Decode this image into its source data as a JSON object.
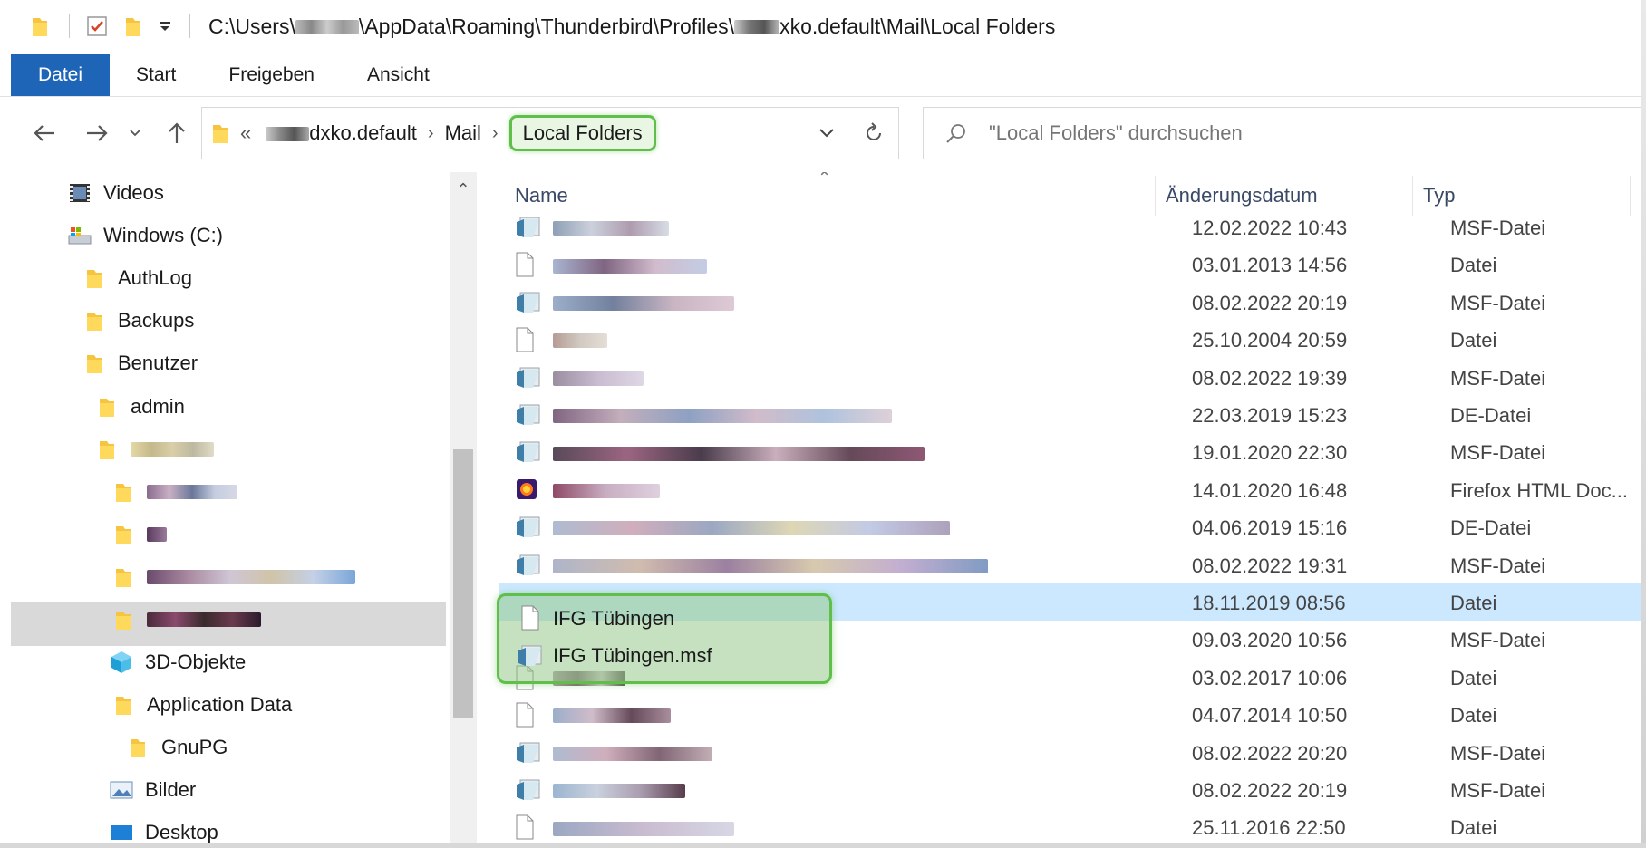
{
  "titlebar": {
    "path_prefix": "C:\\Users\\",
    "path_mid": "\\AppData\\Roaming\\Thunderbird\\Profiles\\",
    "path_suffix": "xko.default\\Mail\\Local Folders"
  },
  "ribbon": {
    "tabs": [
      "Datei",
      "Start",
      "Freigeben",
      "Ansicht"
    ]
  },
  "address": {
    "overflow": "«",
    "crumb_profile_suffix": "dxko.default",
    "crumb_mail": "Mail",
    "crumb_current": "Local Folders"
  },
  "search": {
    "placeholder": "\"Local Folders\" durchsuchen"
  },
  "tree": {
    "videos": "Videos",
    "windows_c": "Windows (C:)",
    "authlog": "AuthLog",
    "backups": "Backups",
    "benutzer": "Benutzer",
    "admin": "admin",
    "objekte3d": "3D-Objekte",
    "appdata": "Application Data",
    "gnupg": "GnuPG",
    "bilder": "Bilder",
    "desktop": "Desktop"
  },
  "columns": {
    "name": "Name",
    "date": "Änderungsdatum",
    "type": "Typ"
  },
  "files": [
    {
      "date": "12.02.2022 10:43",
      "type": "MSF-Datei",
      "icon": "msf-file-icon"
    },
    {
      "date": "03.01.2013 14:56",
      "type": "Datei",
      "icon": "generic-file-icon"
    },
    {
      "date": "08.02.2022 20:19",
      "type": "MSF-Datei",
      "icon": "msf-file-icon"
    },
    {
      "date": "25.10.2004 20:59",
      "type": "Datei",
      "icon": "generic-file-icon"
    },
    {
      "date": "08.02.2022 19:39",
      "type": "MSF-Datei",
      "icon": "msf-file-icon"
    },
    {
      "date": "22.03.2019 15:23",
      "type": "DE-Datei",
      "icon": "msf-file-icon"
    },
    {
      "date": "19.01.2020 22:30",
      "type": "MSF-Datei",
      "icon": "msf-file-icon"
    },
    {
      "date": "14.01.2020 16:48",
      "type": "Firefox HTML Doc...",
      "icon": "firefox-icon"
    },
    {
      "date": "04.06.2019 15:16",
      "type": "DE-Datei",
      "icon": "msf-file-icon"
    },
    {
      "date": "08.02.2022 19:31",
      "type": "MSF-Datei",
      "icon": "msf-file-icon"
    },
    {
      "name": "IFG Tübingen",
      "date": "18.11.2019 08:56",
      "type": "Datei",
      "icon": "generic-file-icon",
      "selected": true
    },
    {
      "name": "IFG Tübingen.msf",
      "date": "09.03.2020 10:56",
      "type": "MSF-Datei",
      "icon": "msf-file-icon"
    },
    {
      "date": "03.02.2017 10:06",
      "type": "Datei",
      "icon": "generic-file-icon"
    },
    {
      "date": "04.07.2014 10:50",
      "type": "Datei",
      "icon": "generic-file-icon"
    },
    {
      "date": "08.02.2022 20:20",
      "type": "MSF-Datei",
      "icon": "msf-file-icon"
    },
    {
      "date": "08.02.2022 20:19",
      "type": "MSF-Datei",
      "icon": "msf-file-icon"
    },
    {
      "date": "25.11.2016 22:50",
      "type": "Datei",
      "icon": "generic-file-icon"
    }
  ]
}
